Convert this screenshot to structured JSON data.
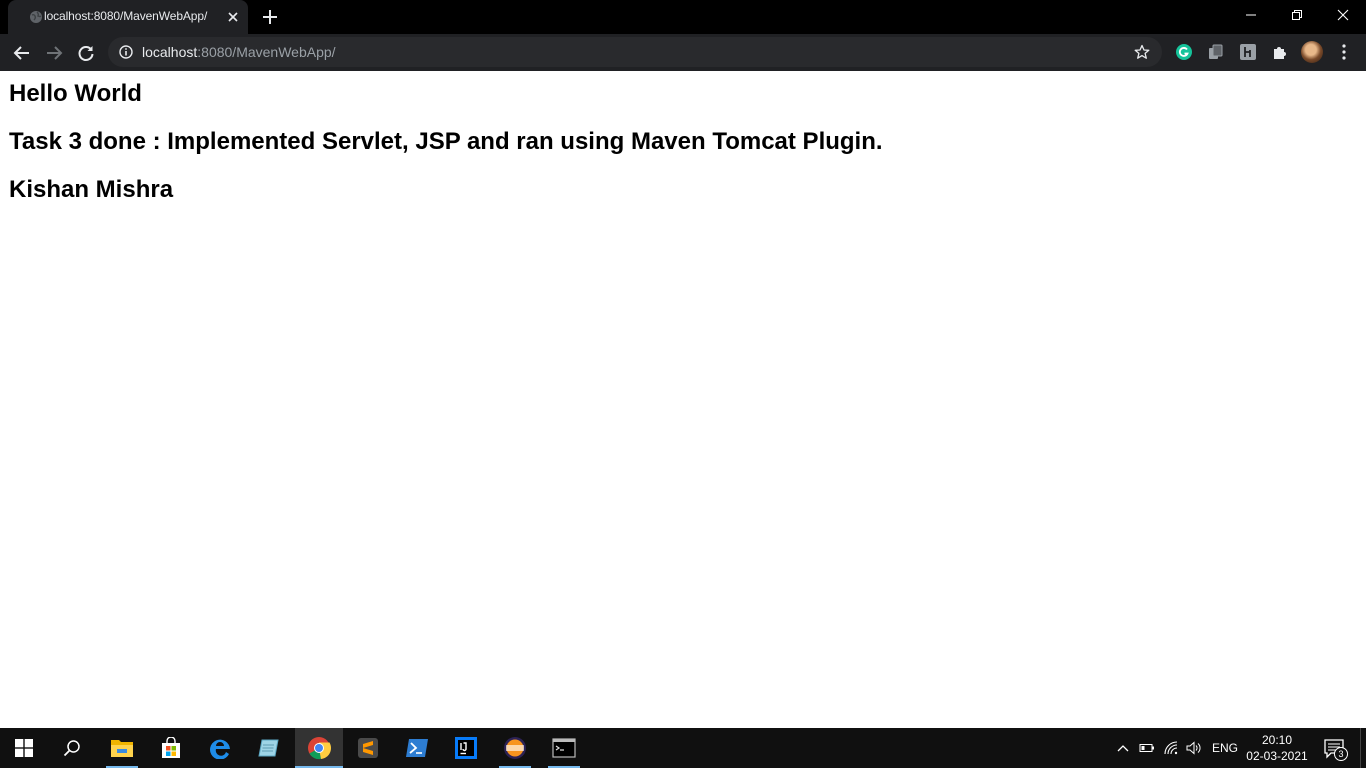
{
  "browser": {
    "tab": {
      "title": "localhost:8080/MavenWebApp/"
    },
    "address": {
      "host": "localhost",
      "rest": ":8080/MavenWebApp/"
    }
  },
  "page": {
    "line1": "Hello World",
    "line2": "Task 3 done : Implemented Servlet, JSP and ran using Maven Tomcat Plugin.",
    "line3": "Kishan Mishra"
  },
  "taskbar": {
    "apps": [
      "start-icon",
      "search-icon",
      "file-explorer-icon",
      "store-icon",
      "edge-icon",
      "notepad-icon",
      "chrome-icon",
      "sublime-text-icon",
      "powershell-icon",
      "intellij-icon",
      "eclipse-icon",
      "command-prompt-icon"
    ],
    "language": "ENG",
    "time": "20:10",
    "date": "02-03-2021",
    "notification_count": "3"
  },
  "colors": {
    "accent": "#76b9ed",
    "titlebar": "#000000",
    "toolbar": "#202124",
    "omnibox": "#292a2d"
  }
}
